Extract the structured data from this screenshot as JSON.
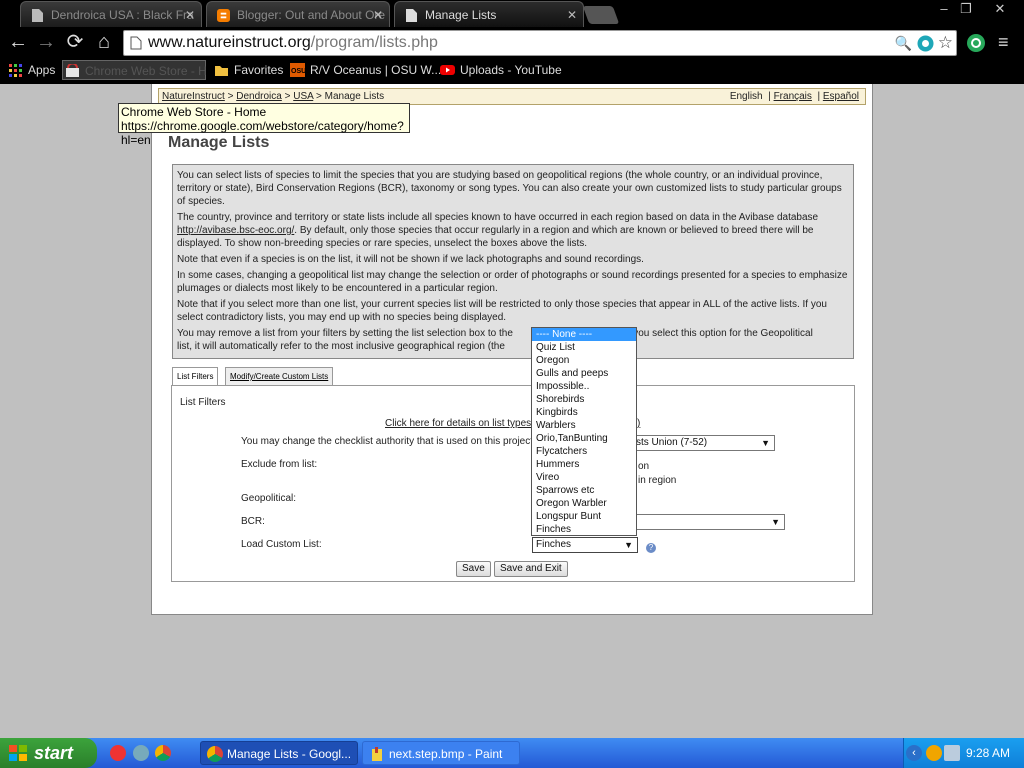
{
  "browser": {
    "tabs": [
      {
        "title": "Dendroica USA : Black Fra",
        "active": false
      },
      {
        "title": "Blogger: Out and About Ore",
        "active": false
      },
      {
        "title": "Manage Lists",
        "active": true
      }
    ],
    "url_domain": "www.natureinstruct.org",
    "url_path": "/program/lists.php",
    "bookmarks": [
      {
        "label": "Apps"
      },
      {
        "label": "Chrome Web Store - H"
      },
      {
        "label": "Favorites"
      },
      {
        "label": "R/V Oceanus | OSU W..."
      },
      {
        "label": "Uploads - YouTube"
      }
    ],
    "tooltip_line1": "Chrome Web Store - Home",
    "tooltip_line2": "https://chrome.google.com/webstore/category/home?hl=en"
  },
  "page": {
    "breadcrumb": {
      "items": [
        "NatureInstruct",
        "Dendroica",
        "USA"
      ],
      "separator": ">",
      "current": "Manage Lists"
    },
    "languages": [
      "English",
      "Français",
      "Español"
    ],
    "title": "Manage Lists",
    "info": {
      "p1": "You can select lists of species to limit the species that you are studying based on geopolitical regions (the whole country, or an individual province, territory or state), Bird Conservation Regions (BCR), taxonomy or song types. You can also create your own customized lists to study particular groups of species.",
      "p2_pre": "The country, province and territory or state lists include all species known to have occurred in each region based on data in the Avibase database ",
      "p2_link": "http://avibase.bsc-eoc.org/",
      "p2_post": ". By default, only those species that occur regularly in a region and which are known or believed to breed there will be displayed. To show non-breeding species or rare species, unselect the boxes above the lists.",
      "p3": "Note that even if a species is on the list, it will not be shown if we lack photographs and sound recordings.",
      "p4": "In some cases, changing a geopolitical list may change the selection or order of photographs or sound recordings presented for a species to emphasize plumages or dialects most likely to be encountered in a particular region.",
      "p5": "Note that if you select more than one list, your current species list will be restricted to only those species that appear in ALL of the active lists. If you select contradictory lists, you may end up with no species being displayed.",
      "p6a": "You may remove a list from your filters by setting the list selection box to the",
      "p6b": "If you select this option for the Geopolitical",
      "p7": "list, it will automatically refer to the most inclusive geographical region (the"
    },
    "tabs": [
      "List Filters",
      "Modify/Create Custom Lists"
    ],
    "filters": {
      "title": "List Filters",
      "details_link": "Click here for details on list types a",
      "details_link_tail": ")",
      "authority_label": "You may change the checklist authority that is used on this project:",
      "authority_value": "sts Union (7-52)",
      "exclude_label": "Exclude from list:",
      "exclude_opt1": "on",
      "exclude_opt2": "in region",
      "geopolitical_label": "Geopolitical:",
      "bcr_label": "BCR:",
      "custom_label": "Load Custom List:",
      "custom_value": "Finches",
      "save_label": "Save",
      "save_exit_label": "Save and Exit"
    },
    "dropdown_options": [
      "---- None ----",
      "Quiz List",
      "Oregon",
      "Gulls and peeps",
      "Impossible..",
      "Shorebirds",
      "Kingbirds",
      "Warblers",
      "Orio,TanBunting",
      "Flycatchers",
      "Hummers",
      "Vireo",
      "Sparrows etc",
      "Oregon Warbler",
      "Longspur Bunt",
      "Finches"
    ],
    "dropdown_selected_index": 0
  },
  "taskbar": {
    "start_label": "start",
    "tasks": [
      {
        "label": "Manage Lists - Googl...",
        "active": true
      },
      {
        "label": "next.step.bmp - Paint",
        "active": false
      }
    ],
    "clock": "9:28 AM"
  }
}
